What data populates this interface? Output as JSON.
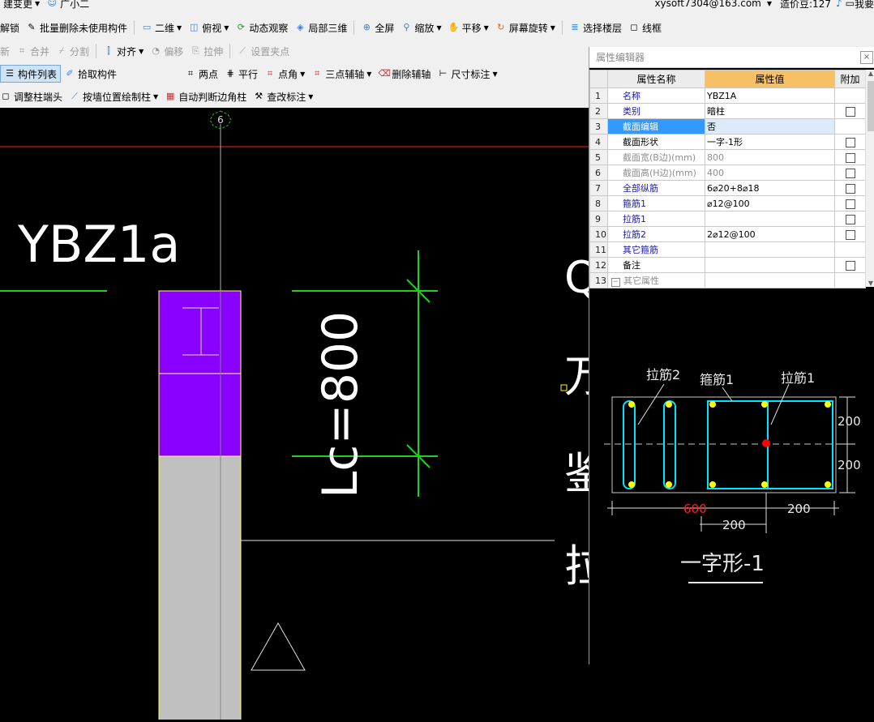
{
  "topbar": {
    "left_items": [
      "建变更",
      "广小二"
    ],
    "email": "xysoft7304@163.com",
    "credits": "造价豆:127",
    "right_label": "我要"
  },
  "toolbar1": [
    "解锁",
    "批量删除未使用构件",
    "二维",
    "俯视",
    "动态观察",
    "局部三维",
    "全屏",
    "缩放",
    "平移",
    "屏幕旋转",
    "选择楼层",
    "线框"
  ],
  "toolbar2": [
    "新",
    "合并",
    "分割",
    "对齐",
    "偏移",
    "拉伸",
    "设置夹点"
  ],
  "toolbar3": [
    "构件列表",
    "拾取构件",
    "两点",
    "平行",
    "点角",
    "三点辅轴",
    "删除辅轴",
    "尺寸标注"
  ],
  "toolbar4": [
    "调整柱端头",
    "按墙位置绘制柱",
    "自动判断边角柱",
    "查改标注"
  ],
  "canvas": {
    "axis_label": "6",
    "column_label": "YBZ1a",
    "dimension_label": "Lc=800",
    "partial_chars": [
      "Q",
      "万",
      "鉴",
      "拉"
    ]
  },
  "panel": {
    "title": "属性编辑器",
    "close": "×",
    "headers": [
      "属性名称",
      "属性值",
      "附加"
    ],
    "rows": [
      {
        "num": "1",
        "name": "名称",
        "value": "YBZ1A"
      },
      {
        "num": "2",
        "name": "类别",
        "value": "暗柱"
      },
      {
        "num": "3",
        "name": "截面编辑",
        "value": "否"
      },
      {
        "num": "4",
        "name": "截面形状",
        "value": "一字-1形"
      },
      {
        "num": "5",
        "name": "截面宽(B边)(mm)",
        "value": "800"
      },
      {
        "num": "6",
        "name": "截面高(H边)(mm)",
        "value": "400"
      },
      {
        "num": "7",
        "name": "全部纵筋",
        "value": "6⌀20+8⌀18"
      },
      {
        "num": "8",
        "name": "箍筋1",
        "value": "⌀12@100"
      },
      {
        "num": "9",
        "name": "拉筋1",
        "value": ""
      },
      {
        "num": "10",
        "name": "拉筋2",
        "value": "2⌀12@100"
      },
      {
        "num": "11",
        "name": "其它箍筋",
        "value": ""
      },
      {
        "num": "12",
        "name": "备注",
        "value": ""
      },
      {
        "num": "13",
        "name": "其它属性",
        "value": ""
      }
    ]
  },
  "section": {
    "label_lajin2": "拉筋2",
    "label_gujin1": "箍筋1",
    "label_lajin1": "拉筋1",
    "dim_200_a": "200",
    "dim_200_b": "200",
    "dim_600": "600",
    "dim_200_c": "200",
    "dim_200_d": "200",
    "title": "一字形-1"
  },
  "colors": {
    "accent": "#f7c064",
    "highlight": "#3399ff",
    "rebar": "#00e5ff",
    "bar_dot": "#ffff00",
    "column_fill": "#8a00ff"
  }
}
